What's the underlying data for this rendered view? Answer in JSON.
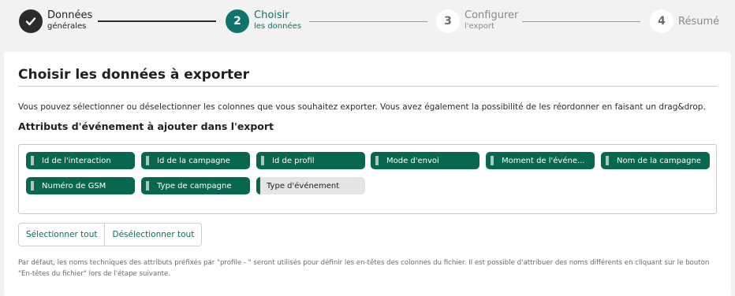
{
  "stepper": {
    "steps": [
      {
        "number": "",
        "title": "Données",
        "subtitle": "générales",
        "state": "done"
      },
      {
        "number": "2",
        "title": "Choisir",
        "subtitle": "les données",
        "state": "active"
      },
      {
        "number": "3",
        "title": "Configurer",
        "subtitle": "l'export",
        "state": "pending"
      },
      {
        "number": "4",
        "title": "Résumé",
        "subtitle": "",
        "state": "pending"
      }
    ]
  },
  "colors": {
    "accent": "#0e7469",
    "chip_selected": "#08684f",
    "chip_unselected": "#e3e4e3",
    "done_step": "#2b2b2b"
  },
  "main": {
    "title": "Choisir les données à exporter",
    "description": "Vous pouvez sélectionner ou déselectionner les colonnes que vous souhaitez exporter. Vous avez également la possibilité de les réordonner en faisant un drag&drop.",
    "section_title": "Attributs d'événement à ajouter dans l'export",
    "attributes": [
      {
        "label": "Id de l'interaction",
        "selected": true
      },
      {
        "label": "Id de la campagne",
        "selected": true
      },
      {
        "label": "Id de profil",
        "selected": true
      },
      {
        "label": "Mode d'envoi",
        "selected": true
      },
      {
        "label": "Moment de l'événe...",
        "selected": true
      },
      {
        "label": "Nom de la campagne",
        "selected": true
      },
      {
        "label": "Numéro de GSM",
        "selected": true
      },
      {
        "label": "Type de campagne",
        "selected": true
      },
      {
        "label": "Type d'événement",
        "selected": false
      }
    ],
    "select_all_label": "Sélectionner tout",
    "deselect_all_label": "Désélectionner tout",
    "footnote": "Par défaut, les noms techniques des attributs préfixés par \"profile - \" seront utilisés pour définir les en-têtes des colonnes du fichier. Il est possible d'attribuer des noms différents en cliquant sur le bouton \"En-têtes du fichier\" lors de l'étape suivante."
  }
}
